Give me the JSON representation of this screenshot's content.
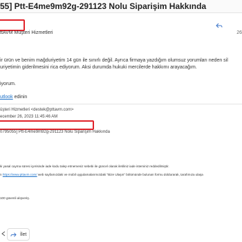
{
  "subject": "55] Ptt-E4me9m92g-291123 Nolu Siparişim Hakkında",
  "sender": {
    "name": "ttAVM Müşteri Hizmetleri",
    "date_short": "26"
  },
  "body": {
    "line1": "ir ürün ve benim mağduriyetim 14 gün ile sınırlı değil. Ayrıca firmaya yazdığım olumsuz yorumları neden sil",
    "line2": "uriyetimin giderilmesini rica ediyorum. Aksi durumda hukuki mercilerde hakkımı arayacağım.",
    "line3": "iyorum.",
    "outlook_link": "utlook",
    "outlook_suffix": "edinin"
  },
  "quoted": {
    "from": "üşteri Hizmetleri <destek@pttavm.com>",
    "date": "ecember 26, 2023 11:45:46 AM",
    "subject": "0795055] Ptt-E4me9m92g-291123 Nolu Siparişim Hakkında",
    "p1": "ki yasal cayma süresi içerisinde iade kodu talep etmemeniz sebebi ile güncel olarak iletiliniz iade isteminiz reddedilmiştir.",
    "p2_prefix": "n",
    "p2_link": "https://www.pttavm.com/",
    "p2_suffix": "web sayfamızdaki ve mobil uygulamalarımızdaki \"Bize Ulaşın\" bölümünde bulunan formu doldurarak, tarafımıza ulaşa",
    "p3": "100 güvenli alışveriş."
  },
  "actions": {
    "forward_label": "İlet"
  }
}
